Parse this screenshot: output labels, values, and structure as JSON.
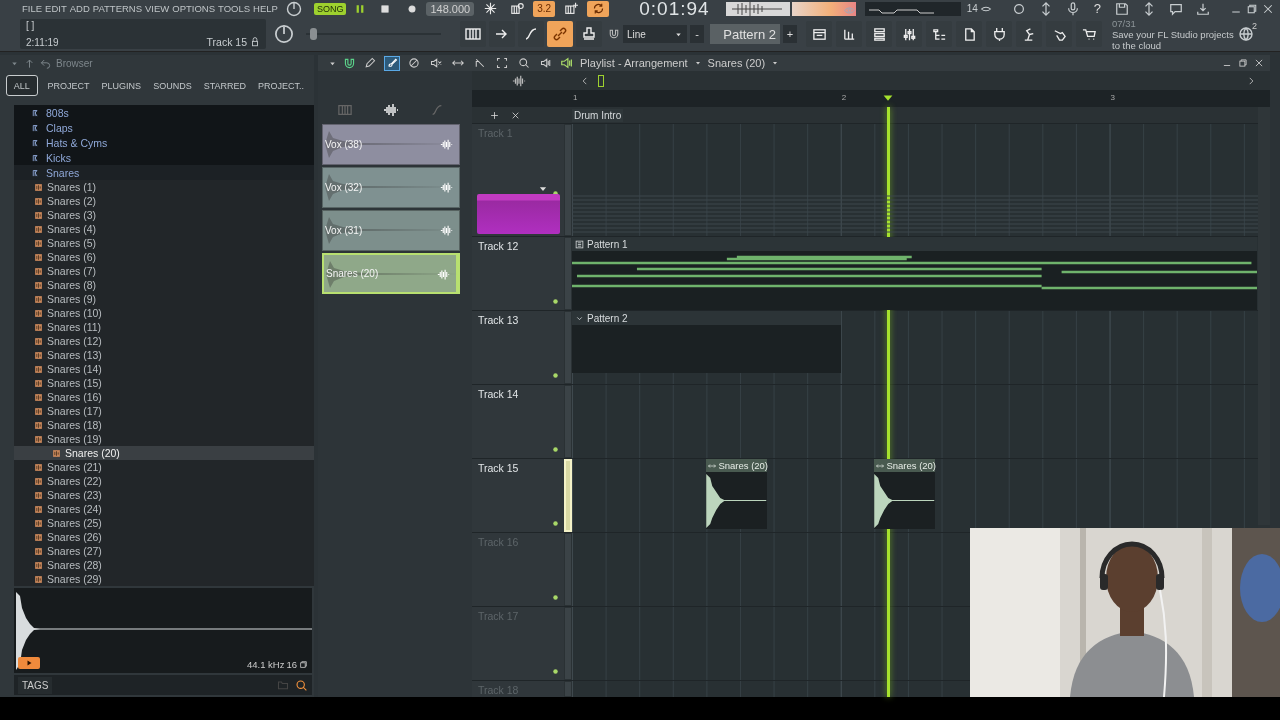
{
  "top_bar": {
    "menu": [
      "FILE",
      "EDIT",
      "ADD",
      "PATTERNS",
      "VIEW",
      "OPTIONS",
      "TOOLS",
      "HELP"
    ],
    "mode": "SONG",
    "tempo": "148.000",
    "pitch": {
      "level": 0.03
    },
    "buttons": [
      {
        "on": false
      },
      {
        "on": false
      },
      {
        "on": true,
        "label": "3.2"
      },
      {
        "on": false
      },
      {
        "on": true
      }
    ],
    "time": "0:01:94",
    "cpu": "14",
    "help": "?",
    "hint": {
      "brackets": "[ ]",
      "time": "2:11:19",
      "target": "Track 15"
    },
    "tools": [
      {
        "on": false
      },
      {
        "on": false
      },
      {
        "on": false
      },
      {
        "on": true
      },
      {
        "on": false
      }
    ],
    "snap": "Line",
    "pattern": "Pattern 2",
    "minus": "-",
    "plus": "+",
    "news": {
      "date": "07/31",
      "text": "Save your FL Studio projects to the cloud"
    },
    "notifications": "2"
  },
  "browser": {
    "title": "Browser",
    "tabs": [
      {
        "label": "ALL",
        "selected": true
      },
      {
        "label": "PROJECT",
        "selected": false
      },
      {
        "label": "PLUGINS",
        "selected": false
      },
      {
        "label": "SOUNDS",
        "selected": false
      },
      {
        "label": "STARRED",
        "selected": false
      },
      {
        "label": "PROJECT..",
        "selected": false
      }
    ],
    "folders": [
      {
        "label": "808s",
        "selected": false
      },
      {
        "label": "Claps",
        "selected": false
      },
      {
        "label": "Hats & Cyms",
        "selected": false
      },
      {
        "label": "Kicks",
        "selected": false
      },
      {
        "label": "Snares",
        "selected": true
      }
    ],
    "items": [
      {
        "label": "Snares (1)",
        "selected": false
      },
      {
        "label": "Snares (2)",
        "selected": false
      },
      {
        "label": "Snares (3)",
        "selected": false
      },
      {
        "label": "Snares (4)",
        "selected": false
      },
      {
        "label": "Snares (5)",
        "selected": false
      },
      {
        "label": "Snares (6)",
        "selected": false
      },
      {
        "label": "Snares (7)",
        "selected": false
      },
      {
        "label": "Snares (8)",
        "selected": false
      },
      {
        "label": "Snares (9)",
        "selected": false
      },
      {
        "label": "Snares (10)",
        "selected": false
      },
      {
        "label": "Snares (11)",
        "selected": false
      },
      {
        "label": "Snares (12)",
        "selected": false
      },
      {
        "label": "Snares (13)",
        "selected": false
      },
      {
        "label": "Snares (14)",
        "selected": false
      },
      {
        "label": "Snares (15)",
        "selected": false
      },
      {
        "label": "Snares (16)",
        "selected": false
      },
      {
        "label": "Snares (17)",
        "selected": false
      },
      {
        "label": "Snares (18)",
        "selected": false
      },
      {
        "label": "Snares (19)",
        "selected": false
      },
      {
        "label": "Snares (20)",
        "selected": true
      },
      {
        "label": "Snares (21)",
        "selected": false
      },
      {
        "label": "Snares (22)",
        "selected": false
      },
      {
        "label": "Snares (23)",
        "selected": false
      },
      {
        "label": "Snares (24)",
        "selected": false
      },
      {
        "label": "Snares (25)",
        "selected": false
      },
      {
        "label": "Snares (26)",
        "selected": false
      },
      {
        "label": "Snares (27)",
        "selected": false
      },
      {
        "label": "Snares (28)",
        "selected": false
      },
      {
        "label": "Snares (29)",
        "selected": false
      }
    ],
    "sample_rate": "44.1 kHz",
    "bit_depth": "16",
    "tags": "TAGS"
  },
  "playlist": {
    "title": "Playlist - Arrangement",
    "clip_source": "Snares (20)",
    "tools": [
      {
        "selected": false
      },
      {
        "selected": true
      },
      {
        "selected": false
      },
      {
        "selected": false
      },
      {
        "selected": false
      },
      {
        "selected": false
      },
      {
        "selected": false
      },
      {
        "selected": false
      },
      {
        "selected": false
      }
    ],
    "channels": [
      {
        "label": "Vox (38)",
        "color": "#8e8ea0",
        "selected": false
      },
      {
        "label": "Vox (32)",
        "color": "#7f9191",
        "selected": false
      },
      {
        "label": "Vox (31)",
        "color": "#7d8f8c",
        "selected": false
      },
      {
        "label": "Snares (20)",
        "color": "#8fa889",
        "selected": true
      }
    ],
    "ruler": [
      "1",
      "2",
      "3"
    ],
    "marker": "Drum Intro",
    "tracks": [
      {
        "name": "Track 1",
        "active": false,
        "selected": false,
        "clips": [
          {
            "kind": "ghost"
          }
        ]
      },
      {
        "name": "Track 12",
        "active": true,
        "selected": false,
        "clips": [
          {
            "kind": "pattern",
            "label": "Pattern 1"
          }
        ]
      },
      {
        "name": "Track 13",
        "active": true,
        "selected": false,
        "clips": [
          {
            "kind": "group",
            "label": "Pattern 2"
          }
        ]
      },
      {
        "name": "Track 14",
        "active": true,
        "selected": false
      },
      {
        "name": "Track 15",
        "active": true,
        "selected": true,
        "clips": [
          {
            "kind": "audio",
            "label": "Snares (20)"
          },
          {
            "kind": "audio",
            "label": "Snares (20)"
          }
        ]
      },
      {
        "name": "Track 16",
        "active": false,
        "selected": false
      },
      {
        "name": "Track 17",
        "active": false,
        "selected": false
      },
      {
        "name": "Track 18",
        "active": false,
        "selected": false
      }
    ]
  }
}
